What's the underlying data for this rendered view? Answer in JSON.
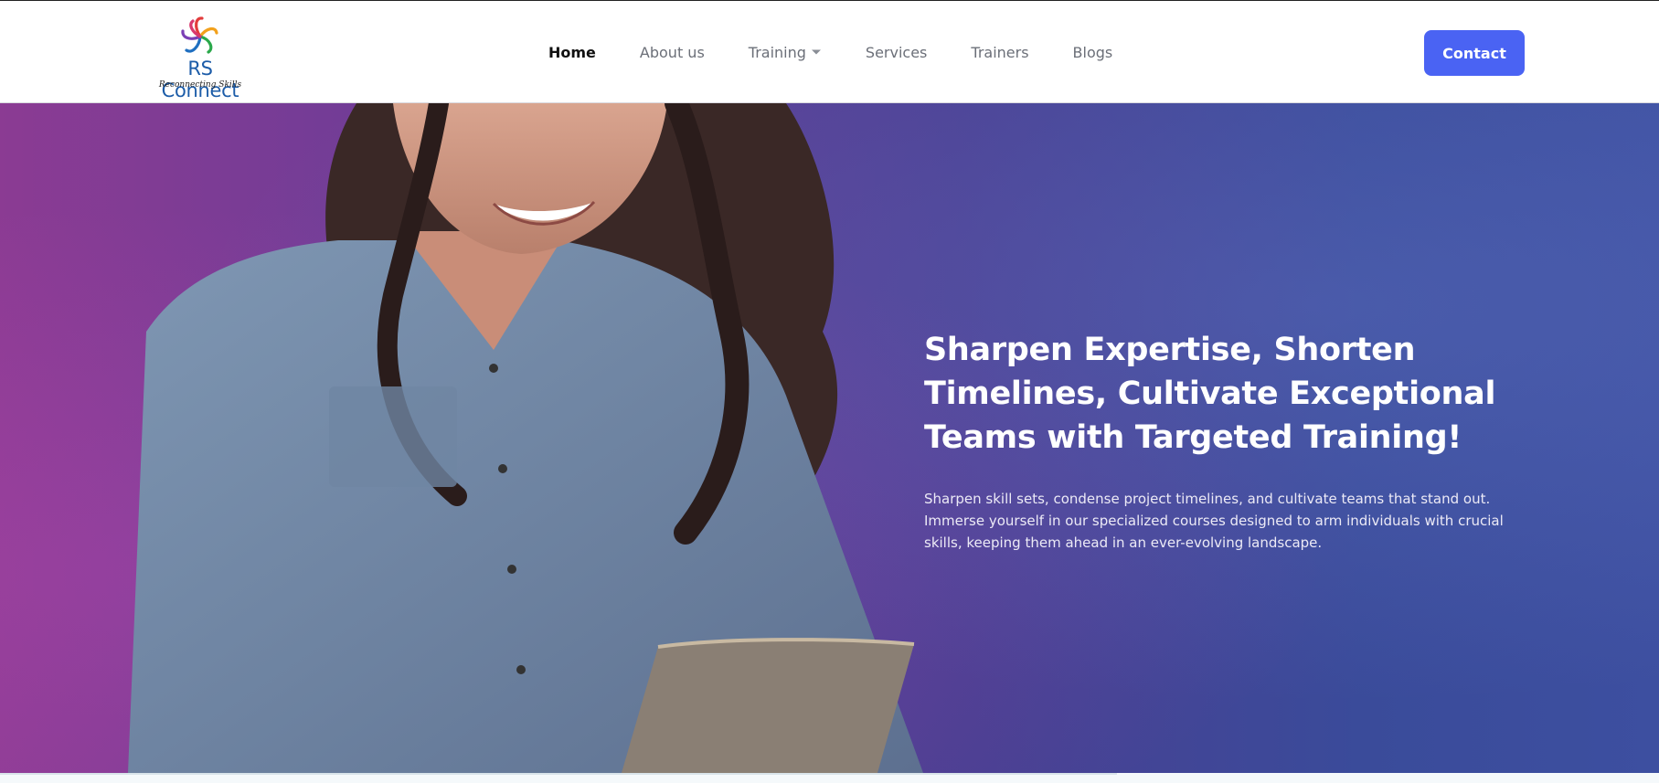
{
  "brand": {
    "name": "RS Connect",
    "tagline": "Reconnecting Skills"
  },
  "nav": {
    "items": [
      {
        "label": "Home",
        "active": true
      },
      {
        "label": "About us",
        "active": false
      },
      {
        "label": "Training",
        "active": false,
        "has_dropdown": true
      },
      {
        "label": "Services",
        "active": false
      },
      {
        "label": "Trainers",
        "active": false
      },
      {
        "label": "Blogs",
        "active": false
      }
    ],
    "contact_label": "Contact"
  },
  "hero": {
    "title": "Sharpen Expertise, Shorten Timelines, Cultivate Exceptional Teams with Targeted Training!",
    "text": "Sharpen skill sets, condense project timelines, and cultivate teams that stand out. Immerse yourself in our specialized courses designed to arm individuals with crucial skills, keeping them ahead in an ever-evolving landscape."
  },
  "icons": {
    "logo": "flower-logo-icon",
    "training_dropdown": "chevron-down-icon"
  },
  "colors": {
    "accent": "#4a63f3",
    "brand_text": "#1c5ca8",
    "hero_left": "#8b3b93",
    "hero_right": "#3d4fa0"
  }
}
